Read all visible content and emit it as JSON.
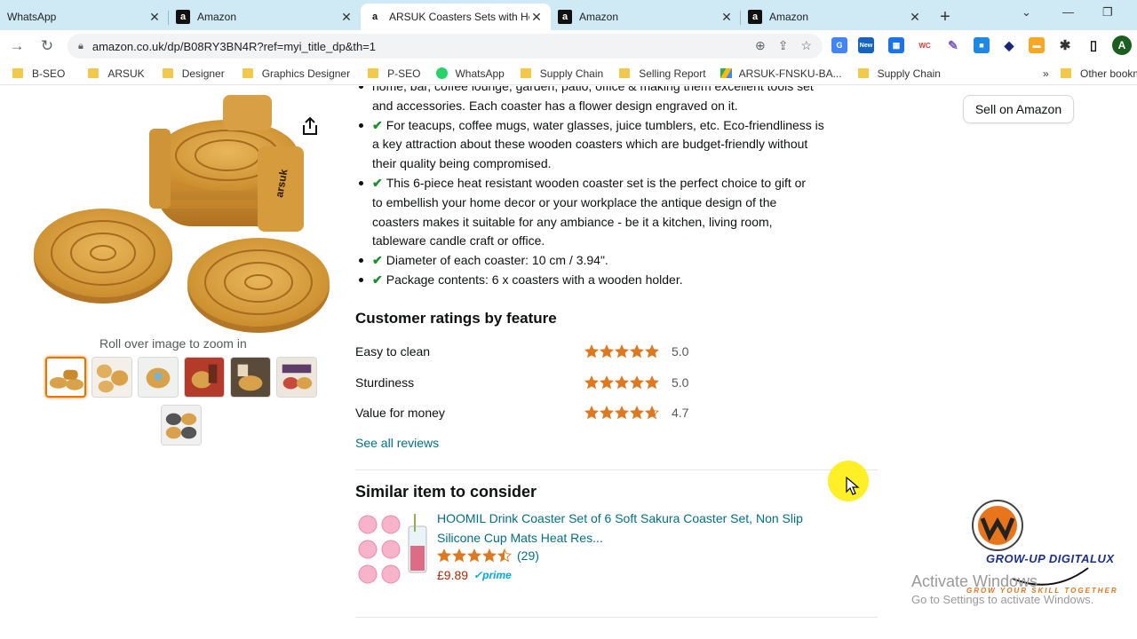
{
  "tabs": [
    {
      "title": "WhatsApp",
      "favicon": "whatsapp-icon",
      "active": false
    },
    {
      "title": "Amazon",
      "favicon": "amazon-icon",
      "active": false
    },
    {
      "title": "ARSUK Coasters Sets with Ho",
      "favicon": "amazon-icon",
      "active": true
    },
    {
      "title": "Amazon",
      "favicon": "amazon-icon",
      "active": false
    },
    {
      "title": "Amazon",
      "favicon": "amazon-icon",
      "active": false
    }
  ],
  "address": {
    "url": "amazon.co.uk/dp/B08RY3BN4R?ref=myi_title_dp&th=1"
  },
  "profile_initial": "A",
  "ext_new_badge": "New",
  "ext_wc": "WC",
  "bookmarks": {
    "items": [
      "B-SEO",
      "ARSUK",
      "Designer",
      "Graphics Designer",
      "P-SEO",
      "WhatsApp",
      "Supply Chain",
      "Selling Report",
      "ARSUK-FNSKU-BA...",
      "Supply Chain"
    ],
    "more": "»",
    "other": "Other bookmarks"
  },
  "product": {
    "zoom_hint": "Roll over image to zoom in",
    "brand_on_holder": "arsuk",
    "bullets": [
      {
        "check": true,
        "lines": [
          "home, bar, coffee lounge, garden, patio, office & making them excellent tools set",
          "and accessories. Each coaster has a flower design engraved on it."
        ],
        "partial": true
      },
      {
        "check": true,
        "lines": [
          "For teacups, coffee mugs, water glasses, juice tumblers, etc. Eco-friendliness is",
          "a key attraction about these wooden coasters which are budget-friendly without",
          "their quality being compromised."
        ]
      },
      {
        "check": true,
        "lines": [
          "This 6-piece heat resistant wooden coaster set is the perfect choice to gift or",
          "to embellish your home decor or your workplace the antique design of the",
          "coasters makes it suitable for any ambiance - be it a kitchen, living room,",
          "tableware candle craft or office."
        ]
      },
      {
        "check": true,
        "lines": [
          "Diameter of each coaster: 10 cm / 3.94\"."
        ]
      },
      {
        "check": true,
        "lines": [
          "Package contents: 6 x coasters with a wooden holder."
        ]
      }
    ]
  },
  "ratings": {
    "heading": "Customer ratings by feature",
    "features": [
      {
        "label": "Easy to clean",
        "value": "5.0",
        "stars": 5.0
      },
      {
        "label": "Sturdiness",
        "value": "5.0",
        "stars": 5.0
      },
      {
        "label": "Value for money",
        "value": "4.7",
        "stars": 4.7
      }
    ],
    "see_all": "See all reviews"
  },
  "similar": {
    "heading": "Similar item to consider",
    "title_lines": [
      "HOOMIL Drink Coaster Set of 6 Soft Sakura Coaster Set, Non Slip",
      "Silicone Cup Mats Heat Res..."
    ],
    "stars": 4.5,
    "count": "(29)",
    "price": "£9.89",
    "prime": "prime"
  },
  "sell_button": "Sell on Amazon",
  "watermark": {
    "brand": "GROW-UP DIGITALUX",
    "tagline": "GROW YOUR SKILL TOGETHER",
    "activate_title": "Activate Windows",
    "activate_sub": "Go to Settings to activate Windows."
  },
  "colors": {
    "star": "#de7921",
    "link": "#007185",
    "price": "#b12704",
    "check": "#1a8f2b",
    "tabbar": "#cfe9f5"
  }
}
